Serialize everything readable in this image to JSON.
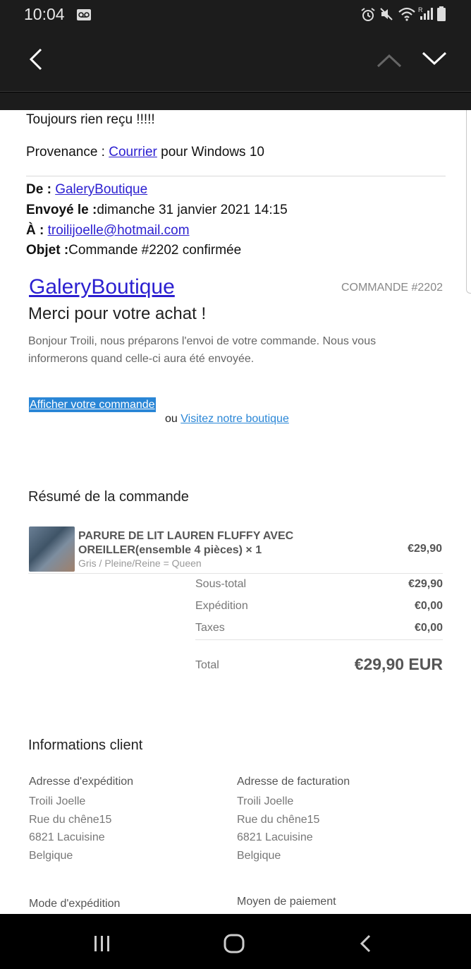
{
  "status_bar": {
    "time": "10:04",
    "icons": [
      "voicemail-icon",
      "alarm-icon",
      "mute-icon",
      "wifi-icon",
      "signal-icon",
      "battery-icon"
    ]
  },
  "app_bar": {
    "back_icon": "back-arrow-icon",
    "prev_icon": "chevron-up-icon",
    "next_icon": "chevron-down-icon"
  },
  "message": {
    "body_line": "Toujours rien reçu !!!!!",
    "provenance_prefix": "Provenance : ",
    "provenance_link": "Courrier",
    "provenance_suffix": " pour Windows 10",
    "from_label": "De : ",
    "from_value": "GaleryBoutique",
    "sent_label": "Envoyé le :",
    "sent_value": "dimanche 31 janvier 2021 14:15",
    "to_label": "À : ",
    "to_value": "troilijoelle@hotmail.com",
    "subject_label": "Objet :",
    "subject_value": "Commande #2202 confirmée"
  },
  "order": {
    "brand": "GaleryBoutique",
    "order_number": "COMMANDE #2202",
    "thanks": "Merci pour votre achat !",
    "intro": "Bonjour Troili, nous préparons l'envoi de votre commande. Nous vous informerons quand celle-ci aura été envoyée.",
    "view_order_button": "Afficher votre commande",
    "or_text": "ou ",
    "visit_shop_link": "Visitez notre boutique"
  },
  "summary": {
    "title": "Résumé de la commande",
    "item": {
      "name": "PARURE DE LIT LAUREN FLUFFY AVEC OREILLER(ensemble 4 pièces) × 1",
      "variant": "Gris / Pleine/Reine = Queen",
      "price": "€29,90"
    },
    "rows": [
      {
        "label": "Sous-total",
        "value": "€29,90"
      },
      {
        "label": "Expédition",
        "value": "€0,00"
      },
      {
        "label": "Taxes",
        "value": "€0,00"
      }
    ],
    "total_label": "Total",
    "total_value": "€29,90 EUR"
  },
  "customer": {
    "title": "Informations client",
    "shipping_address_title": "Adresse d'expédition",
    "shipping_address": [
      "Troili Joelle",
      "Rue du chêne15",
      "6821 Lacuisine",
      "Belgique"
    ],
    "billing_address_title": "Adresse de facturation",
    "billing_address": [
      "Troili Joelle",
      "Rue du chêne15",
      "6821 Lacuisine",
      "Belgique"
    ],
    "shipping_method_title": "Mode d'expédition",
    "payment_method_title": "Moyen de paiement"
  },
  "nav_bar": {
    "recents_icon": "recents-icon",
    "home_icon": "home-icon",
    "back_icon": "back-icon"
  }
}
